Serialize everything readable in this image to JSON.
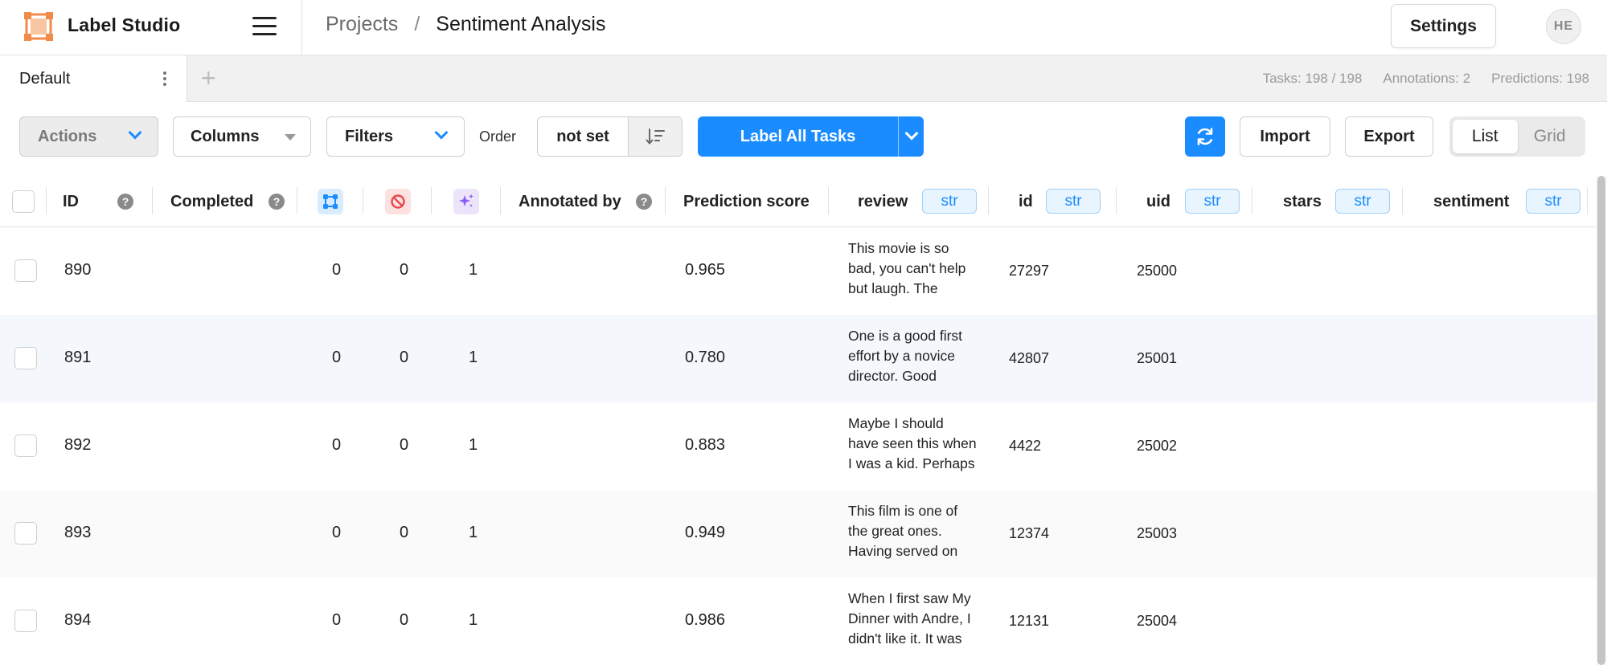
{
  "app": {
    "brand": "Label Studio",
    "colors": {
      "accent": "#1a8cff",
      "logo": "#f28a49"
    }
  },
  "breadcrumb": {
    "projects": "Projects",
    "separator": "/",
    "current": "Sentiment Analysis"
  },
  "header": {
    "settings_label": "Settings",
    "avatar_initials": "HE"
  },
  "tabs": [
    {
      "label": "Default"
    }
  ],
  "add_tab_label": "+",
  "stats": {
    "tasks": "Tasks: 198 / 198",
    "annotations": "Annotations: 2",
    "predictions": "Predictions: 198"
  },
  "toolbar": {
    "actions_label": "Actions",
    "columns_label": "Columns",
    "filters_label": "Filters",
    "order_label": "Order",
    "order_value": "not set",
    "label_all_label": "Label All Tasks",
    "import_label": "Import",
    "export_label": "Export",
    "view_list": "List",
    "view_grid": "Grid"
  },
  "columns": {
    "id": "ID",
    "completed": "Completed",
    "total_annotations_icon": "annotations-icon",
    "cancelled_icon": "cancelled-icon",
    "predictions_icon": "sparkle-icon",
    "annotated_by": "Annotated by",
    "prediction_score": "Prediction score",
    "review": "review",
    "data_id": "id",
    "uid": "uid",
    "stars": "stars",
    "sentiment": "sentiment",
    "type_badge": "str"
  },
  "rows": [
    {
      "id": "890",
      "annotations": "0",
      "cancelled": "0",
      "predictions": "1",
      "score": "0.965",
      "review_lines": [
        "This movie is so",
        "bad, you can't help",
        "but laugh. The"
      ],
      "data_id": "27297",
      "uid": "25000"
    },
    {
      "id": "891",
      "annotations": "0",
      "cancelled": "0",
      "predictions": "1",
      "score": "0.780",
      "review_lines": [
        "One is a good first",
        "effort by a novice",
        "director. Good"
      ],
      "data_id": "42807",
      "uid": "25001"
    },
    {
      "id": "892",
      "annotations": "0",
      "cancelled": "0",
      "predictions": "1",
      "score": "0.883",
      "review_lines": [
        "Maybe I should",
        "have seen this when",
        "I was a kid. Perhaps"
      ],
      "data_id": "4422",
      "uid": "25002"
    },
    {
      "id": "893",
      "annotations": "0",
      "cancelled": "0",
      "predictions": "1",
      "score": "0.949",
      "review_lines": [
        "This film is one of",
        "the great ones.",
        "Having served on"
      ],
      "data_id": "12374",
      "uid": "25003"
    },
    {
      "id": "894",
      "annotations": "0",
      "cancelled": "0",
      "predictions": "1",
      "score": "0.986",
      "review_lines": [
        "When I first saw My",
        "Dinner with Andre, I",
        "didn't like it. It was"
      ],
      "data_id": "12131",
      "uid": "25004"
    }
  ]
}
